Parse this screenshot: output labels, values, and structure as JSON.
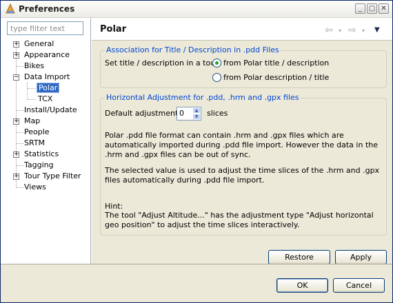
{
  "window": {
    "title": "Preferences",
    "app_icon": "eclipse-icon"
  },
  "window_controls": {
    "minimize": "_",
    "maximize": "▢",
    "close": "✕"
  },
  "filter": {
    "placeholder": "type filter text",
    "value": ""
  },
  "tree": {
    "general": "General",
    "appearance": "Appearance",
    "bikes": "Bikes",
    "data_import": "Data Import",
    "polar": "Polar",
    "tcx": "TCX",
    "install_update": "Install/Update",
    "map": "Map",
    "people": "People",
    "srtm": "SRTM",
    "statistics": "Statistics",
    "tagging": "Tagging",
    "tour_type_filter": "Tour Type Filter",
    "views": "Views"
  },
  "page": {
    "title": "Polar",
    "nav_back": "⇦",
    "nav_forward": "⇨",
    "menu": "▼"
  },
  "group1": {
    "label": "Association for Title / Description in .pdd Files",
    "prompt": "Set title / description in a tour",
    "option1": "from Polar title / description",
    "option2": "from Polar description / title",
    "selected": 1
  },
  "group2": {
    "label": "Horizontal Adjustment for .pdd, .hrm and .gpx files",
    "adjust_label": "Default adjustment:",
    "adjust_value": "0",
    "adjust_unit": "slices",
    "para1": "Polar .pdd file format can contain .hrm and .gpx files which are automatically imported during .pdd file import. However the data in the .hrm and .gpx files can be out of sync.",
    "para2": "The selected value is used to adjust the time slices of the .hrm and .gpx files automatically during .pdd file import.",
    "hint_title": "Hint:",
    "hint_text": "The tool \"Adjust Altitude...\" has the adjustment type \"Adjust horizontal geo position\" to adjust the time slices interactively."
  },
  "buttons": {
    "restore_defaults": "Restore Defaults",
    "apply": "Apply",
    "ok": "OK",
    "cancel": "Cancel"
  }
}
